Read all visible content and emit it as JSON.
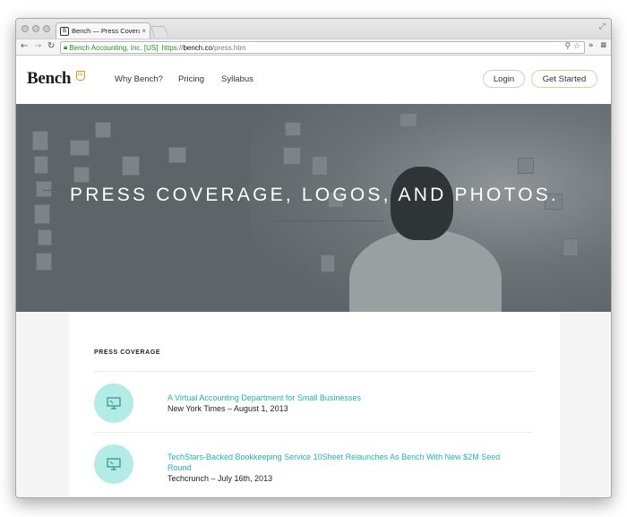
{
  "browser": {
    "tab_title": "Bench — Press Coverage, L",
    "tab_close": "×",
    "favicon_glyph": "B",
    "ev_label": "Bench Accounting, Inc. [US]",
    "url_scheme": "https://",
    "url_host": "bench.co",
    "url_path": "/press.htm",
    "overflow_glyph": "»",
    "menu_glyph": "≡"
  },
  "site": {
    "logo": "Bench",
    "logo_mark": "PF",
    "nav": [
      "Why Bench?",
      "Pricing",
      "Syllabus"
    ],
    "login_label": "Login",
    "get_started_label": "Get Started"
  },
  "hero": {
    "title": "PRESS COVERAGE, LOGOS, AND PHOTOS."
  },
  "press": {
    "section_label": "PRESS COVERAGE",
    "items": [
      {
        "title": "A Virtual Accounting Department for Small Businesses",
        "meta": "New York Times – August 1, 2013"
      },
      {
        "title": "TechStars-Backed Bookkeeping Service 10Sheet Relaunches As Bench With New $2M Seed Round",
        "meta": "Techcrunch – July 16th, 2013"
      }
    ]
  },
  "colors": {
    "accent": "#22b5a8",
    "icon_circle": "#b3ebe6",
    "logo_gold": "#c9a227"
  }
}
